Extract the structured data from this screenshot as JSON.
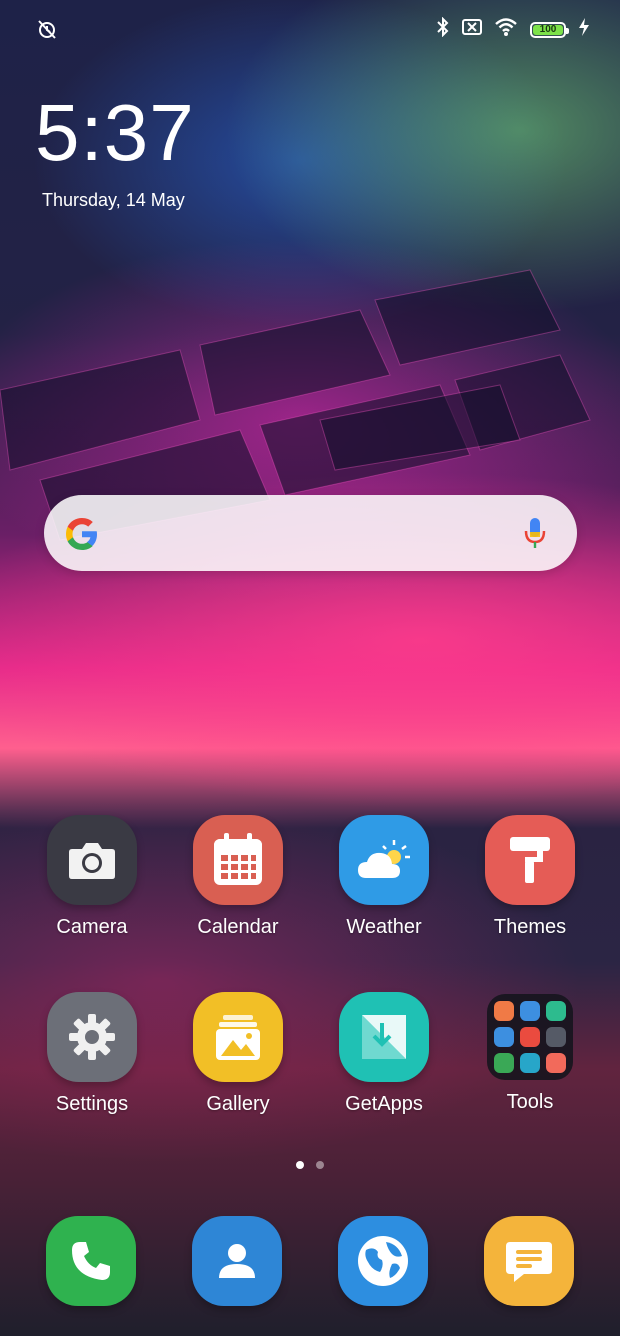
{
  "status_bar": {
    "left_icon": "alarm-off-icon",
    "right_icons": [
      "bluetooth-icon",
      "no-sim-icon",
      "wifi-icon"
    ],
    "battery_level": "100",
    "charging_icon": "lightning-icon",
    "battery_color": "#7de24a"
  },
  "clock": {
    "time": "5:37",
    "date": "Thursday, 14 May"
  },
  "search": {
    "logo": "google-g-icon",
    "mic": "microphone-icon"
  },
  "apps": [
    {
      "label": "Camera",
      "icon": "camera-icon",
      "color": "#3a3a44"
    },
    {
      "label": "Calendar",
      "icon": "calendar-icon",
      "color": "#d95f52"
    },
    {
      "label": "Weather",
      "icon": "weather-icon",
      "color": "#2f9be6"
    },
    {
      "label": "Themes",
      "icon": "paint-roller-icon",
      "color": "#e55c56"
    },
    {
      "label": "Settings",
      "icon": "gear-icon",
      "color": "#6c6f78"
    },
    {
      "label": "Gallery",
      "icon": "gallery-icon",
      "color": "#f2bf26"
    },
    {
      "label": "GetApps",
      "icon": "getapps-icon",
      "color": "#1fc1b4"
    },
    {
      "label": "Tools",
      "icon": "folder-icon",
      "color": "#14141c"
    }
  ],
  "page_indicator": {
    "pages": 2,
    "current": 1
  },
  "dock": [
    {
      "icon": "phone-icon",
      "color": "#2fb24f"
    },
    {
      "icon": "contacts-icon",
      "color": "#2e86d6"
    },
    {
      "icon": "browser-globe-icon",
      "color": "#2d8ee0"
    },
    {
      "icon": "messages-icon",
      "color": "#f4b43b"
    }
  ]
}
